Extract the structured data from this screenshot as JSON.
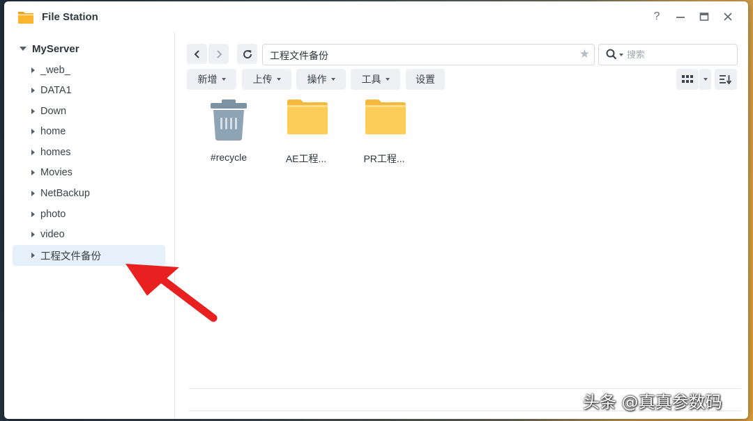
{
  "window": {
    "title": "File Station",
    "controls": {
      "help": "?",
      "minimize": "–",
      "maximize": "▭",
      "close": "✕"
    }
  },
  "sidebar": {
    "root": "MyServer",
    "items": [
      {
        "label": "_web_"
      },
      {
        "label": "DATA1"
      },
      {
        "label": "Down"
      },
      {
        "label": "home"
      },
      {
        "label": "homes"
      },
      {
        "label": "Movies"
      },
      {
        "label": "NetBackup"
      },
      {
        "label": "photo"
      },
      {
        "label": "video"
      },
      {
        "label": "工程文件备份",
        "selected": true
      }
    ]
  },
  "toolbar": {
    "back_icon": "chevron-left-icon",
    "forward_icon": "chevron-right-icon",
    "refresh_icon": "refresh-icon",
    "path": "工程文件备份",
    "favorite_icon": "star-icon",
    "search": {
      "placeholder": "搜索"
    },
    "buttons": {
      "create": "新增",
      "upload": "上传",
      "action": "操作",
      "tools": "工具",
      "settings": "设置"
    },
    "view_icon": "grid-view-icon",
    "sort_icon": "sort-icon"
  },
  "files": [
    {
      "name": "#recycle",
      "type": "recycle-bin"
    },
    {
      "name": "AE工程...",
      "type": "folder"
    },
    {
      "name": "PR工程...",
      "type": "folder"
    }
  ],
  "colors": {
    "folder": "#fdcd58",
    "folder_tab": "#f6b93b",
    "recycle": "#7d93a4",
    "selection": "#e6f0fb",
    "arrow": "#e8201f"
  },
  "watermark": "头条 @真真参数码"
}
